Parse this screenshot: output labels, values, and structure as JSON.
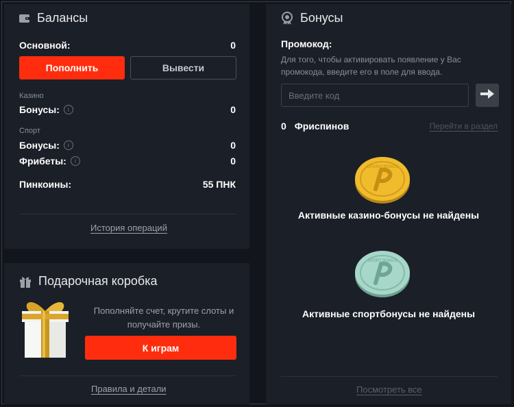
{
  "balances": {
    "title": "Балансы",
    "main_label": "Основной:",
    "main_value": "0",
    "deposit_label": "Пополнить",
    "withdraw_label": "Вывести",
    "casino_caption": "Казино",
    "casino_bonus_label": "Бонусы:",
    "casino_bonus_value": "0",
    "sport_caption": "Спорт",
    "sport_bonus_label": "Бонусы:",
    "sport_bonus_value": "0",
    "freebets_label": "Фрибеты:",
    "freebets_value": "0",
    "pincoins_label": "Пинкоины:",
    "pincoins_value": "55 ПНК",
    "history_link": "История операций"
  },
  "gift": {
    "title": "Подарочная коробка",
    "description": "Пополняйте счет, крутите слоты и получайте призы.",
    "play_button": "К играм",
    "rules_link": "Правила и детали"
  },
  "bonuses": {
    "title": "Бонусы",
    "promo_label": "Промокод:",
    "promo_description": "Для того, чтобы активировать появление у Вас промокода, введите его в поле для ввода.",
    "promo_placeholder": "Введите код",
    "freespins_count": "0",
    "freespins_label": "Фриспинов",
    "goto_section_link": "Перейти в раздел",
    "casino_coin_text": "CASINO BONUS",
    "sport_coin_text": "SPORT BONUS",
    "casino_empty": "Активные казино-бонусы не найдены",
    "sport_empty": "Активные спортбонусы не найдены",
    "view_all_link": "Посмотреть все"
  },
  "colors": {
    "accent_red": "#ff2d0e",
    "panel_bg": "#1b1f27",
    "page_bg": "#12151b",
    "gold_coin": "#e9b52a",
    "sport_coin": "#8fc7b8"
  },
  "icons": [
    "wallet-icon",
    "medal-icon",
    "gift-icon",
    "info-icon",
    "arrow-right-icon"
  ]
}
